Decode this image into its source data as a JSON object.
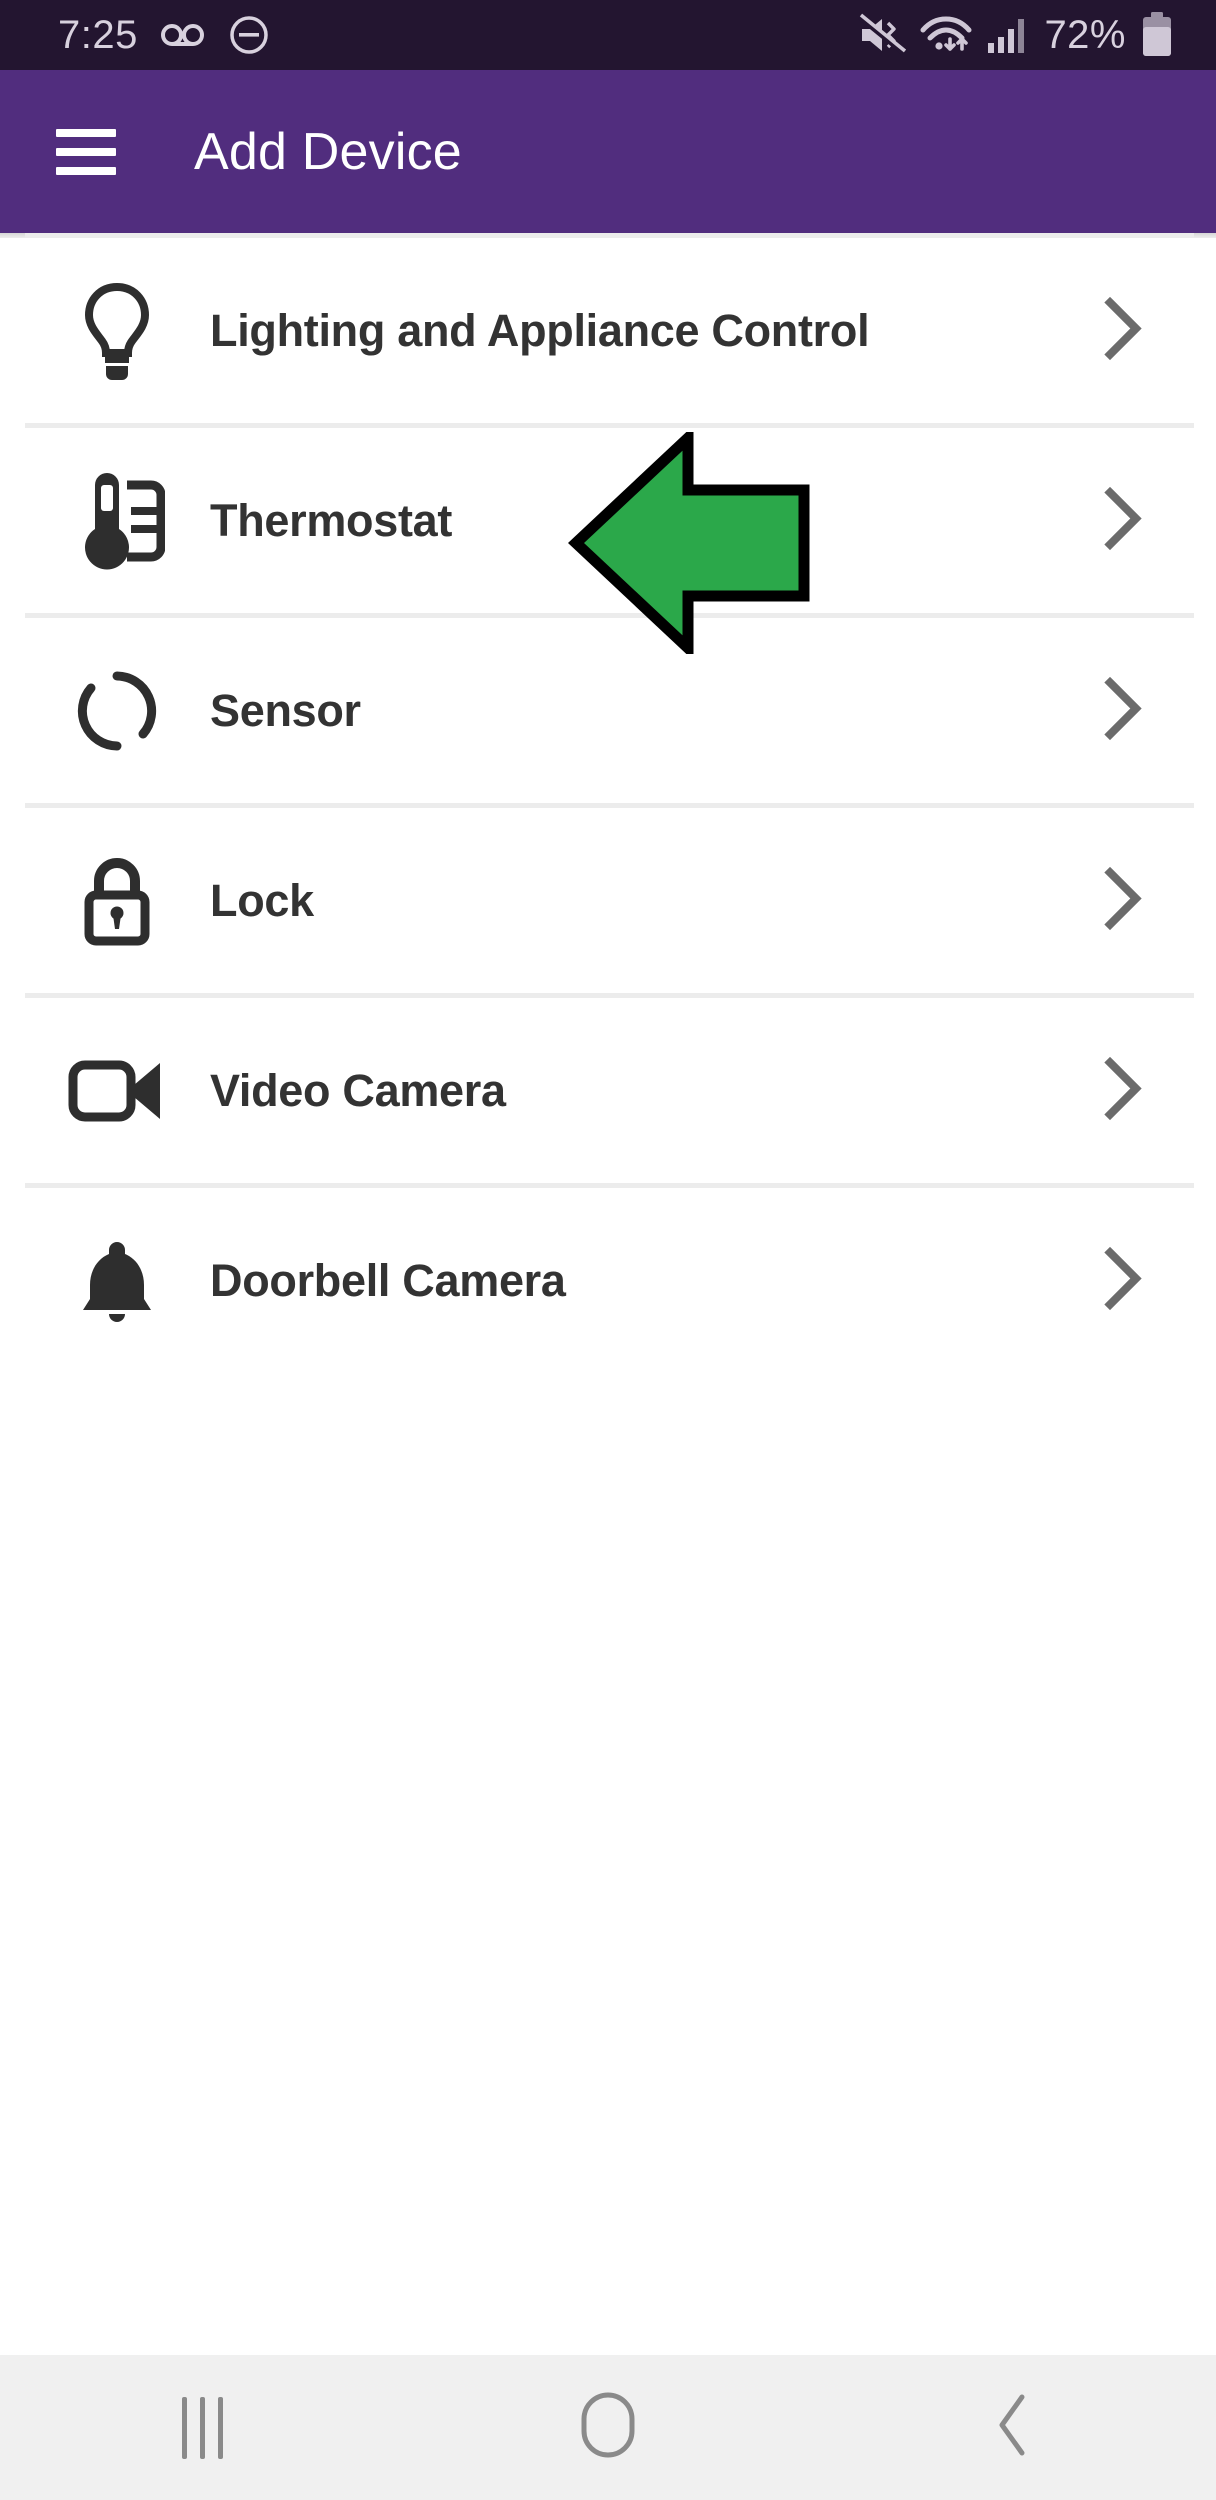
{
  "status_bar": {
    "time": "7:25",
    "battery_percent": "72%",
    "icons": [
      "voicemail-icon",
      "do-not-disturb-icon",
      "mute-vibrate-icon",
      "wifi-data-icon",
      "cellular-signal-icon",
      "battery-icon"
    ],
    "background_color": "#231530",
    "foreground_color": "#d8d1de"
  },
  "app_bar": {
    "title": "Add Device",
    "menu_icon": "hamburger-menu-icon",
    "background_color": "#512d7e",
    "title_color": "#ffffff"
  },
  "list": {
    "chevron_icon": "chevron-right-icon",
    "divider_color": "#ececec",
    "label_color": "#333333",
    "items": [
      {
        "label": "Lighting and Appliance Control",
        "icon": "lightbulb-icon"
      },
      {
        "label": "Thermostat",
        "icon": "thermostat-icon"
      },
      {
        "label": "Sensor",
        "icon": "sensor-icon"
      },
      {
        "label": "Lock",
        "icon": "padlock-icon"
      },
      {
        "label": "Video Camera",
        "icon": "video-camera-icon"
      },
      {
        "label": "Doorbell Camera",
        "icon": "bell-icon"
      }
    ]
  },
  "annotation": {
    "type": "arrow-left-annotation",
    "points_to": "Thermostat",
    "fill_color": "#2ba84a",
    "outline_color": "#000000"
  },
  "nav_bar": {
    "background_color": "#f0f0f0",
    "icon_color": "#8a8a8a",
    "buttons": [
      {
        "name": "recents-button",
        "icon": "recents-icon"
      },
      {
        "name": "home-button",
        "icon": "home-circle-icon"
      },
      {
        "name": "back-button",
        "icon": "chevron-left-icon"
      }
    ]
  }
}
